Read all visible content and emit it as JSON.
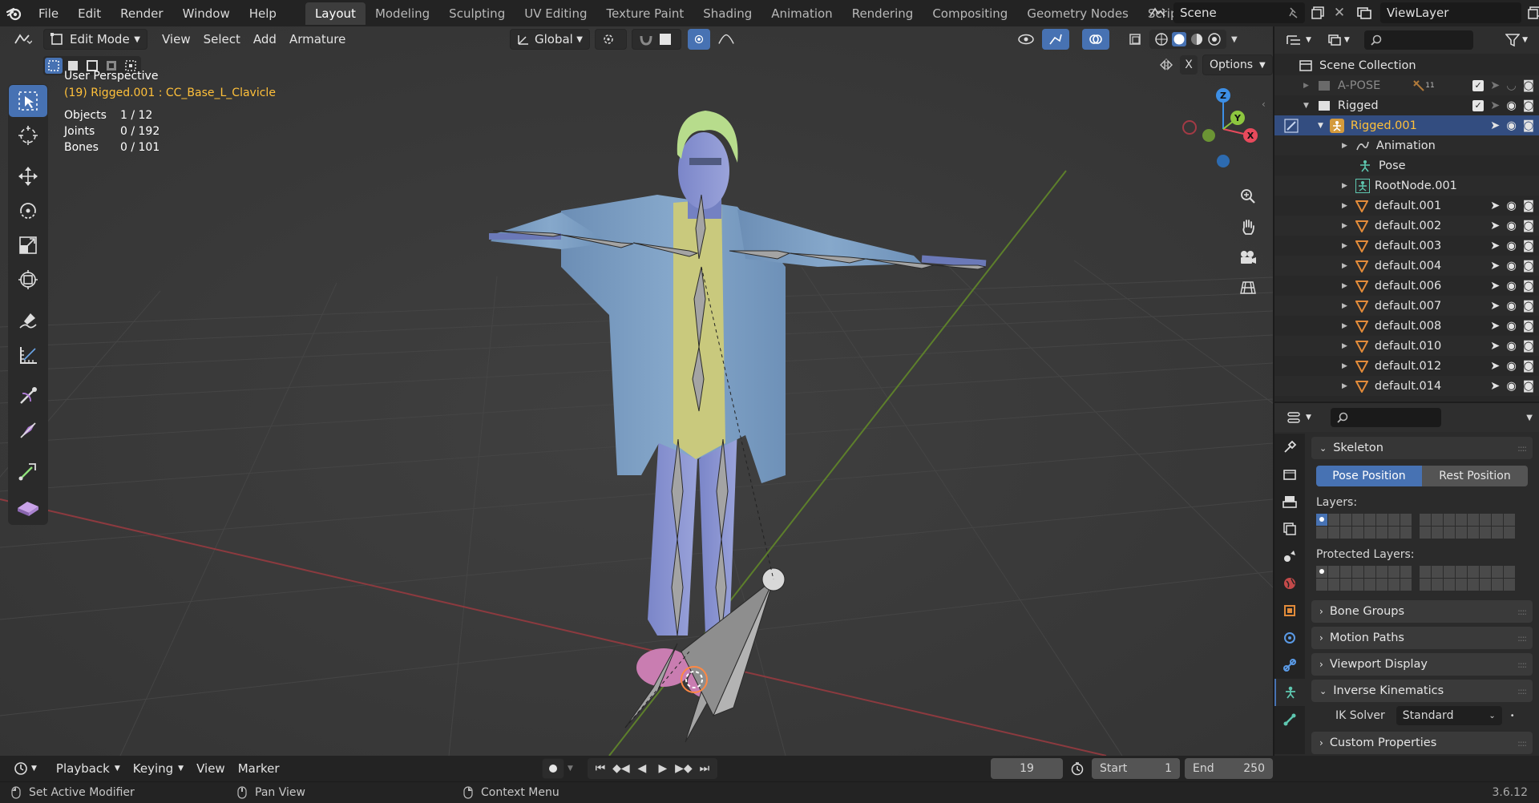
{
  "topbar": {
    "menus": [
      "File",
      "Edit",
      "Render",
      "Window",
      "Help"
    ],
    "workspace_tabs": [
      "Layout",
      "Modeling",
      "Sculpting",
      "UV Editing",
      "Texture Paint",
      "Shading",
      "Animation",
      "Rendering",
      "Compositing",
      "Geometry Nodes",
      "Scripting"
    ],
    "active_tab": "Layout",
    "scene": "Scene",
    "view_layer": "ViewLayer"
  },
  "viewport_header": {
    "mode": "Edit Mode",
    "menus": [
      "View",
      "Select",
      "Add",
      "Armature"
    ],
    "transform_orientation": "Global",
    "options_label": "Options",
    "x_mirror_label": "X"
  },
  "viewport_info": {
    "perspective": "User Perspective",
    "active": "(19) Rigged.001 : CC_Base_L_Clavicle",
    "stats": [
      {
        "label": "Objects",
        "value": "1 / 12"
      },
      {
        "label": "Joints",
        "value": "0 / 192"
      },
      {
        "label": "Bones",
        "value": "0 / 101"
      }
    ]
  },
  "gizmo": {
    "x": "X",
    "y": "Y",
    "z": "Z"
  },
  "outliner": {
    "root": "Scene Collection",
    "rows": [
      {
        "label": "A-POSE",
        "badge": "11"
      },
      {
        "label": "Rigged"
      },
      {
        "label": "Rigged.001"
      },
      {
        "label": "Animation"
      },
      {
        "label": "Pose"
      },
      {
        "label": "RootNode.001"
      },
      {
        "label": "default.001"
      },
      {
        "label": "default.002"
      },
      {
        "label": "default.003"
      },
      {
        "label": "default.004"
      },
      {
        "label": "default.006"
      },
      {
        "label": "default.007"
      },
      {
        "label": "default.008"
      },
      {
        "label": "default.010"
      },
      {
        "label": "default.012"
      },
      {
        "label": "default.014"
      }
    ]
  },
  "properties": {
    "skeleton_label": "Skeleton",
    "pose_position": "Pose Position",
    "rest_position": "Rest Position",
    "layers_label": "Layers:",
    "protected_layers_label": "Protected Layers:",
    "panels": [
      "Bone Groups",
      "Motion Paths",
      "Viewport Display"
    ],
    "ik_label": "Inverse Kinematics",
    "ik_solver_label": "IK Solver",
    "ik_solver_value": "Standard",
    "custom_properties": "Custom Properties"
  },
  "timeline": {
    "menus": [
      "Playback",
      "Keying",
      "View",
      "Marker"
    ],
    "current_frame": "19",
    "start_label": "Start",
    "start_value": "1",
    "end_label": "End",
    "end_value": "250"
  },
  "statusbar": {
    "left": "Set Active Modifier",
    "middle": "Pan View",
    "right": "Context Menu",
    "version": "3.6.12"
  },
  "colors": {
    "accent": "#4772b3",
    "selected_row": "#334d80",
    "active_text": "#ffc03a",
    "axis_x": "#e84a5c",
    "axis_y": "#8dc63f",
    "axis_z": "#3d8fe6"
  }
}
